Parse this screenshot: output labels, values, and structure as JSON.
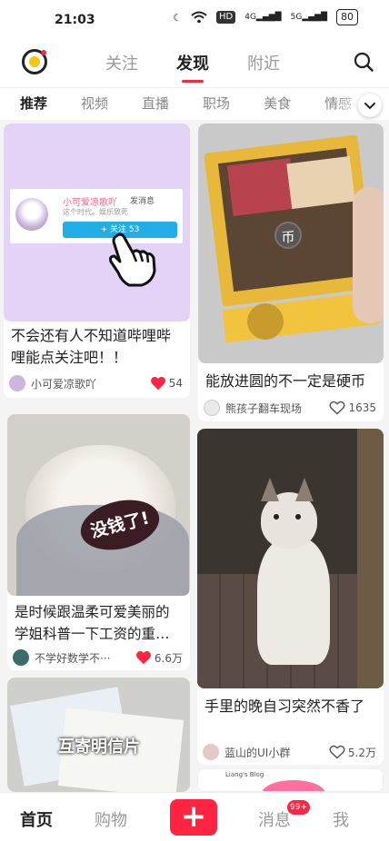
{
  "status": {
    "time": "21:03",
    "hd": "HD",
    "sig1": "4G",
    "sig2": "5G",
    "battery": "80"
  },
  "header": {
    "tabs": [
      "关注",
      "发现",
      "附近"
    ],
    "active_tab": 1
  },
  "categories": {
    "items": [
      "推荐",
      "视频",
      "直播",
      "职场",
      "美食",
      "情感"
    ],
    "active": 0
  },
  "feed": {
    "cards": [
      {
        "title": "不会还有人不知道哔哩哔哩能点关注吧！！",
        "author": "小可爱凉歌吖",
        "likes": "54",
        "liked": true,
        "overlay": {
          "name": "小可爱凉歌吖",
          "sub": "这个时代。娱乐致死",
          "msg": "发消息",
          "follow": "+ 关注 53"
        }
      },
      {
        "title": "能放进圆的不一定是硬币",
        "author": "熊孩子翻车现场",
        "likes": "1635",
        "liked": false,
        "coin": "币"
      },
      {
        "title": "是时候跟温柔可爱美丽的学姐科普一下工资的重…",
        "author": "不学好数学不···",
        "likes": "6.6万",
        "liked": true,
        "caption": "没钱了!"
      },
      {
        "title": "手里的晚自习突然不香了",
        "author": "蓝山的UI小群",
        "likes": "5.2万",
        "liked": false
      },
      {
        "caption": "互寄明信片"
      },
      {
        "caption": "Liang's Blog"
      }
    ]
  },
  "tabbar": {
    "items": [
      "首页",
      "购物",
      "消息",
      "我"
    ],
    "badge": "99+",
    "active": 0
  },
  "colors": {
    "accent": "#ff2442",
    "heart": "#ff2442"
  }
}
